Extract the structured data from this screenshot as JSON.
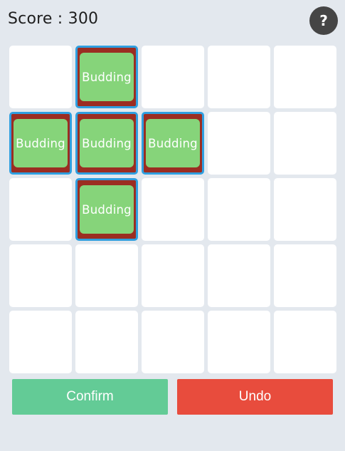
{
  "header": {
    "score_text": "Score : 300",
    "help_label": "?"
  },
  "board": {
    "rows": 5,
    "cols": 5,
    "cells": [
      [
        "",
        "Budding",
        "",
        "",
        ""
      ],
      [
        "Budding",
        "Budding",
        "Budding",
        "",
        ""
      ],
      [
        "",
        "Budding",
        "",
        "",
        ""
      ],
      [
        "",
        "",
        "",
        "",
        ""
      ],
      [
        "",
        "",
        "",
        "",
        ""
      ]
    ]
  },
  "actions": {
    "confirm_label": "Confirm",
    "undo_label": "Undo"
  },
  "colors": {
    "background": "#e3e8ee",
    "plant_fill": "#86d47a",
    "plot_soil": "#9b2d22",
    "selected_border": "#2f9fe0",
    "confirm": "#63cb96",
    "undo": "#e84c3d",
    "help_button": "#454545"
  }
}
